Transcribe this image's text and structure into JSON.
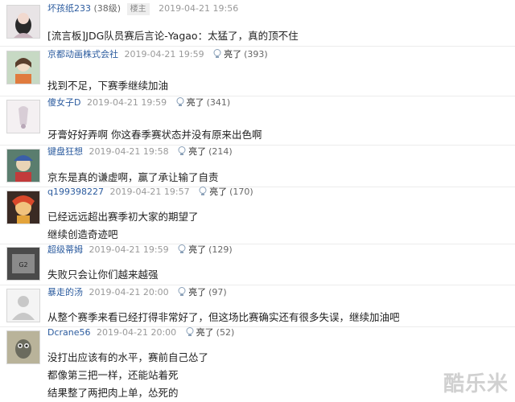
{
  "posts": [
    {
      "username": "坏孩纸233",
      "level": "(38级)",
      "owner_badge": "楼主",
      "time": "2019-04-21 19:56",
      "lines": [
        "[流言板]JDG队员赛后言论-Yagao：太猛了，真的顶不住"
      ]
    },
    {
      "username": "京都动画株式会社",
      "time": "2019-04-21 19:59",
      "light_label": "亮了",
      "light_count": "(393)",
      "lines": [
        "找到不足，下赛季继续加油"
      ]
    },
    {
      "username": "傻女子D",
      "time": "2019-04-21 19:59",
      "light_label": "亮了",
      "light_count": "(341)",
      "lines": [
        "牙膏好好弄啊 你这春季赛状态并没有原来出色啊"
      ]
    },
    {
      "username": "键盘狂想",
      "time": "2019-04-21 19:58",
      "light_label": "亮了",
      "light_count": "(214)",
      "lines": [
        "京东是真的谦虚啊，赢了承让输了自责"
      ]
    },
    {
      "username": "q199398227",
      "time": "2019-04-21 19:57",
      "light_label": "亮了",
      "light_count": "(170)",
      "lines": [
        "已经远远超出赛季初大家的期望了",
        "继续创造奇迹吧"
      ]
    },
    {
      "username": "超级蒂姆",
      "time": "2019-04-21 19:59",
      "light_label": "亮了",
      "light_count": "(129)",
      "lines": [
        "失败只会让你们越来越强"
      ]
    },
    {
      "username": "暴走的汤",
      "time": "2019-04-21 20:00",
      "light_label": "亮了",
      "light_count": "(97)",
      "lines": [
        "从整个赛季来看已经打得非常好了，但这场比赛确实还有很多失误，继续加油吧"
      ]
    },
    {
      "username": "Dcrane56",
      "time": "2019-04-21 20:00",
      "light_label": "亮了",
      "light_count": "(52)",
      "lines": [
        "没打出应该有的水平，赛前自己怂了",
        "都像第三把一样，还能站着死",
        "结果整了两把肉上单，怂死的"
      ]
    }
  ],
  "watermark": "酷乐米",
  "colors": {
    "username": "#2b5b9e",
    "meta": "#999999",
    "text": "#222222"
  }
}
